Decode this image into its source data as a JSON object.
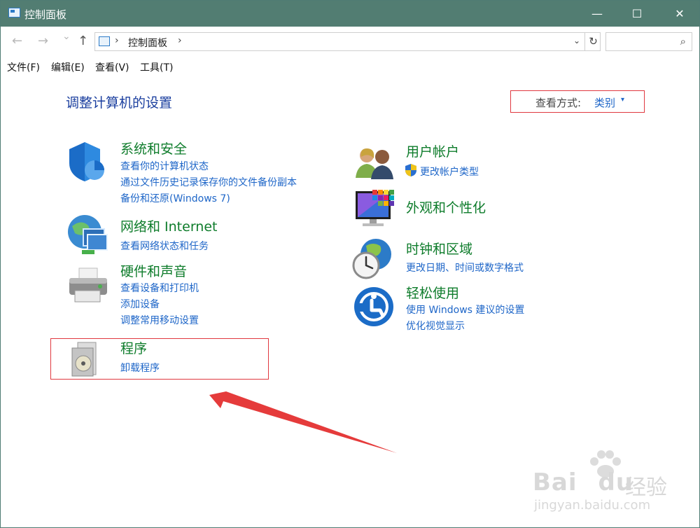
{
  "window": {
    "title": "控制面板",
    "minimize_glyph": "—",
    "maximize_glyph": "☐",
    "close_glyph": "✕"
  },
  "nav": {
    "back_glyph": "←",
    "forward_glyph": "→",
    "recent_glyph": "⌄",
    "up_glyph": "↑",
    "address_sep1": "›",
    "address_text": "控制面板",
    "address_sep2": "›",
    "dropdown_glyph": "⌄",
    "refresh_glyph": "↻",
    "search_glyph": "⌕"
  },
  "menu": {
    "items": [
      "文件(F)",
      "编辑(E)",
      "查看(V)",
      "工具(T)"
    ]
  },
  "content": {
    "page_title": "调整计算机的设置",
    "view_by_label": "查看方式:",
    "view_by_value": "类别",
    "view_by_caret": "▾",
    "categories": [
      {
        "title": "系统和安全",
        "icon": "shield-icon",
        "links": [
          "查看你的计算机状态",
          "通过文件历史记录保存你的文件备份副本",
          "备份和还原(Windows 7)"
        ]
      },
      {
        "title": "网络和 Internet",
        "icon": "network-icon",
        "links": [
          "查看网络状态和任务"
        ]
      },
      {
        "title": "硬件和声音",
        "icon": "printer-icon",
        "links": [
          "查看设备和打印机",
          "添加设备",
          "调整常用移动设置"
        ]
      },
      {
        "title": "程序",
        "icon": "programs-icon",
        "links": [
          "卸载程序"
        ]
      },
      {
        "title": "用户帐户",
        "icon": "users-icon",
        "links": [
          "更改帐户类型"
        ]
      },
      {
        "title": "外观和个性化",
        "icon": "monitor-icon",
        "links": []
      },
      {
        "title": "时钟和区域",
        "icon": "clock-globe-icon",
        "links": [
          "更改日期、时间或数字格式"
        ]
      },
      {
        "title": "轻松使用",
        "icon": "ease-of-access-icon",
        "links": [
          "使用 Windows 建议的设置",
          "优化视觉显示"
        ]
      }
    ]
  },
  "watermark": {
    "brand": "Bai",
    "brand2": "du",
    "cn": "经验",
    "url": "jingyan.baidu.com"
  },
  "colors": {
    "titlebar": "#527d72",
    "category_title": "#0e7c2b",
    "link": "#1e66c8",
    "page_title": "#1b3f9f",
    "highlight": "#e0383f"
  }
}
